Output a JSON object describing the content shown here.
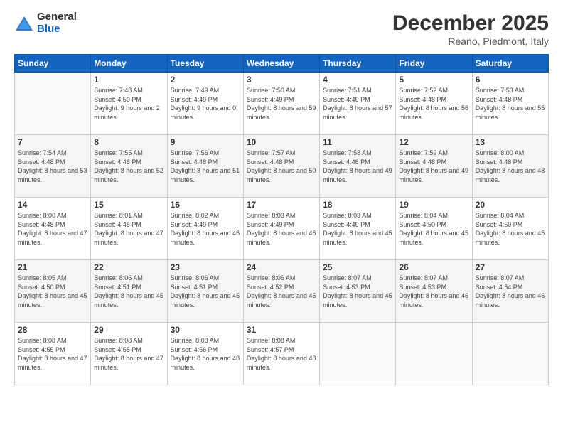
{
  "logo": {
    "general": "General",
    "blue": "Blue"
  },
  "header": {
    "month": "December 2025",
    "location": "Reano, Piedmont, Italy"
  },
  "days_of_week": [
    "Sunday",
    "Monday",
    "Tuesday",
    "Wednesday",
    "Thursday",
    "Friday",
    "Saturday"
  ],
  "weeks": [
    [
      {
        "day": "",
        "sunrise": "",
        "sunset": "",
        "daylight": "",
        "empty": true
      },
      {
        "day": "1",
        "sunrise": "Sunrise: 7:48 AM",
        "sunset": "Sunset: 4:50 PM",
        "daylight": "Daylight: 9 hours and 2 minutes."
      },
      {
        "day": "2",
        "sunrise": "Sunrise: 7:49 AM",
        "sunset": "Sunset: 4:49 PM",
        "daylight": "Daylight: 9 hours and 0 minutes."
      },
      {
        "day": "3",
        "sunrise": "Sunrise: 7:50 AM",
        "sunset": "Sunset: 4:49 PM",
        "daylight": "Daylight: 8 hours and 59 minutes."
      },
      {
        "day": "4",
        "sunrise": "Sunrise: 7:51 AM",
        "sunset": "Sunset: 4:49 PM",
        "daylight": "Daylight: 8 hours and 57 minutes."
      },
      {
        "day": "5",
        "sunrise": "Sunrise: 7:52 AM",
        "sunset": "Sunset: 4:48 PM",
        "daylight": "Daylight: 8 hours and 56 minutes."
      },
      {
        "day": "6",
        "sunrise": "Sunrise: 7:53 AM",
        "sunset": "Sunset: 4:48 PM",
        "daylight": "Daylight: 8 hours and 55 minutes."
      }
    ],
    [
      {
        "day": "7",
        "sunrise": "Sunrise: 7:54 AM",
        "sunset": "Sunset: 4:48 PM",
        "daylight": "Daylight: 8 hours and 53 minutes."
      },
      {
        "day": "8",
        "sunrise": "Sunrise: 7:55 AM",
        "sunset": "Sunset: 4:48 PM",
        "daylight": "Daylight: 8 hours and 52 minutes."
      },
      {
        "day": "9",
        "sunrise": "Sunrise: 7:56 AM",
        "sunset": "Sunset: 4:48 PM",
        "daylight": "Daylight: 8 hours and 51 minutes."
      },
      {
        "day": "10",
        "sunrise": "Sunrise: 7:57 AM",
        "sunset": "Sunset: 4:48 PM",
        "daylight": "Daylight: 8 hours and 50 minutes."
      },
      {
        "day": "11",
        "sunrise": "Sunrise: 7:58 AM",
        "sunset": "Sunset: 4:48 PM",
        "daylight": "Daylight: 8 hours and 49 minutes."
      },
      {
        "day": "12",
        "sunrise": "Sunrise: 7:59 AM",
        "sunset": "Sunset: 4:48 PM",
        "daylight": "Daylight: 8 hours and 49 minutes."
      },
      {
        "day": "13",
        "sunrise": "Sunrise: 8:00 AM",
        "sunset": "Sunset: 4:48 PM",
        "daylight": "Daylight: 8 hours and 48 minutes."
      }
    ],
    [
      {
        "day": "14",
        "sunrise": "Sunrise: 8:00 AM",
        "sunset": "Sunset: 4:48 PM",
        "daylight": "Daylight: 8 hours and 47 minutes."
      },
      {
        "day": "15",
        "sunrise": "Sunrise: 8:01 AM",
        "sunset": "Sunset: 4:48 PM",
        "daylight": "Daylight: 8 hours and 47 minutes."
      },
      {
        "day": "16",
        "sunrise": "Sunrise: 8:02 AM",
        "sunset": "Sunset: 4:49 PM",
        "daylight": "Daylight: 8 hours and 46 minutes."
      },
      {
        "day": "17",
        "sunrise": "Sunrise: 8:03 AM",
        "sunset": "Sunset: 4:49 PM",
        "daylight": "Daylight: 8 hours and 46 minutes."
      },
      {
        "day": "18",
        "sunrise": "Sunrise: 8:03 AM",
        "sunset": "Sunset: 4:49 PM",
        "daylight": "Daylight: 8 hours and 45 minutes."
      },
      {
        "day": "19",
        "sunrise": "Sunrise: 8:04 AM",
        "sunset": "Sunset: 4:50 PM",
        "daylight": "Daylight: 8 hours and 45 minutes."
      },
      {
        "day": "20",
        "sunrise": "Sunrise: 8:04 AM",
        "sunset": "Sunset: 4:50 PM",
        "daylight": "Daylight: 8 hours and 45 minutes."
      }
    ],
    [
      {
        "day": "21",
        "sunrise": "Sunrise: 8:05 AM",
        "sunset": "Sunset: 4:50 PM",
        "daylight": "Daylight: 8 hours and 45 minutes."
      },
      {
        "day": "22",
        "sunrise": "Sunrise: 8:06 AM",
        "sunset": "Sunset: 4:51 PM",
        "daylight": "Daylight: 8 hours and 45 minutes."
      },
      {
        "day": "23",
        "sunrise": "Sunrise: 8:06 AM",
        "sunset": "Sunset: 4:51 PM",
        "daylight": "Daylight: 8 hours and 45 minutes."
      },
      {
        "day": "24",
        "sunrise": "Sunrise: 8:06 AM",
        "sunset": "Sunset: 4:52 PM",
        "daylight": "Daylight: 8 hours and 45 minutes."
      },
      {
        "day": "25",
        "sunrise": "Sunrise: 8:07 AM",
        "sunset": "Sunset: 4:53 PM",
        "daylight": "Daylight: 8 hours and 45 minutes."
      },
      {
        "day": "26",
        "sunrise": "Sunrise: 8:07 AM",
        "sunset": "Sunset: 4:53 PM",
        "daylight": "Daylight: 8 hours and 46 minutes."
      },
      {
        "day": "27",
        "sunrise": "Sunrise: 8:07 AM",
        "sunset": "Sunset: 4:54 PM",
        "daylight": "Daylight: 8 hours and 46 minutes."
      }
    ],
    [
      {
        "day": "28",
        "sunrise": "Sunrise: 8:08 AM",
        "sunset": "Sunset: 4:55 PM",
        "daylight": "Daylight: 8 hours and 47 minutes."
      },
      {
        "day": "29",
        "sunrise": "Sunrise: 8:08 AM",
        "sunset": "Sunset: 4:55 PM",
        "daylight": "Daylight: 8 hours and 47 minutes."
      },
      {
        "day": "30",
        "sunrise": "Sunrise: 8:08 AM",
        "sunset": "Sunset: 4:56 PM",
        "daylight": "Daylight: 8 hours and 48 minutes."
      },
      {
        "day": "31",
        "sunrise": "Sunrise: 8:08 AM",
        "sunset": "Sunset: 4:57 PM",
        "daylight": "Daylight: 8 hours and 48 minutes."
      },
      {
        "day": "",
        "sunrise": "",
        "sunset": "",
        "daylight": "",
        "empty": true
      },
      {
        "day": "",
        "sunrise": "",
        "sunset": "",
        "daylight": "",
        "empty": true
      },
      {
        "day": "",
        "sunrise": "",
        "sunset": "",
        "daylight": "",
        "empty": true
      }
    ]
  ]
}
